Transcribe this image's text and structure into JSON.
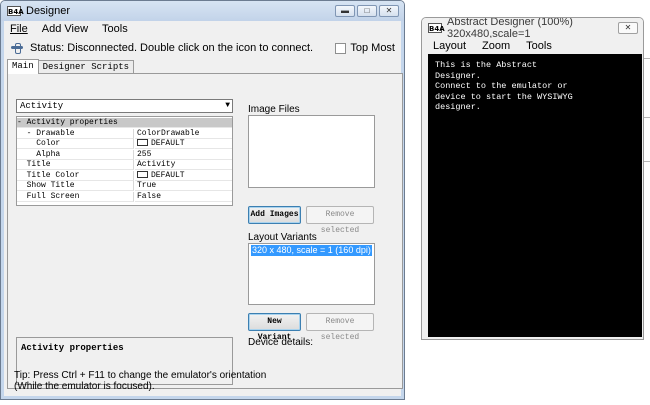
{
  "designer": {
    "title": "Designer",
    "menu": [
      "File",
      "Add View",
      "Tools"
    ],
    "status": "Status: Disconnected. Double click on the icon to connect.",
    "top_most_label": "Top Most",
    "tabs": [
      "Main",
      "Designer Scripts"
    ],
    "view_select": "Activity",
    "properties": [
      {
        "key": "- Activity properties",
        "value": "",
        "category": true
      },
      {
        "key": "  - Drawable",
        "value": "ColorDrawable"
      },
      {
        "key": "    Color",
        "value": "DEFAULT",
        "swatch": true
      },
      {
        "key": "    Alpha",
        "value": "255"
      },
      {
        "key": "  Title",
        "value": "Activity"
      },
      {
        "key": "  Title Color",
        "value": "DEFAULT",
        "swatch": true
      },
      {
        "key": "  Show Title",
        "value": "True"
      },
      {
        "key": "  Full Screen",
        "value": "False"
      }
    ],
    "description": "Activity properties",
    "image_files_label": "Image Files",
    "add_images": "Add Images",
    "remove_selected_images": "Remove selected",
    "layout_variants_label": "Layout Variants",
    "variants": [
      "320 x 480, scale = 1 (160 dpi)"
    ],
    "new_variant": "New Variant",
    "remove_selected_variant": "Remove selected",
    "device_details_label": "Device details:",
    "tip_line1": "Tip: Press Ctrl + F11 to change the emulator's orientation",
    "tip_line2": "(While the emulator is focused)."
  },
  "abstract": {
    "title": "Abstract Designer (100%) 320x480,scale=1",
    "menu": [
      "Layout",
      "Zoom",
      "Tools"
    ],
    "screen_text": "This is the Abstract\nDesigner.\nConnect to the emulator or\ndevice to start the WYSIWYG\ndesigner."
  },
  "icons": {
    "app_icon_text": "B4A",
    "minimize": "minimize-icon",
    "maximize": "maximize-icon",
    "close": "close-icon",
    "connect": "plug-icon",
    "dropdown": "chevron-down-icon"
  }
}
